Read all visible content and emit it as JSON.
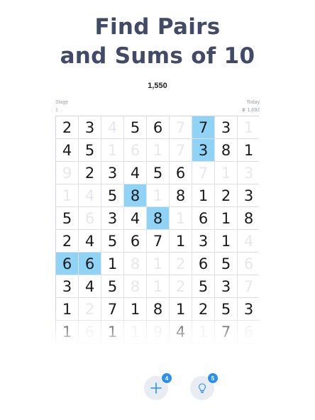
{
  "headline": {
    "line1": "Find Pairs",
    "line2": "and Sums of 10"
  },
  "score": "1,550",
  "stage": {
    "label": "Stage",
    "value": "1"
  },
  "today": {
    "label": "Today",
    "value": "1,692"
  },
  "grid": {
    "rows": [
      [
        {
          "v": "2",
          "s": "a"
        },
        {
          "v": "3",
          "s": "a"
        },
        {
          "v": "4",
          "s": "c"
        },
        {
          "v": "5",
          "s": "a"
        },
        {
          "v": "6",
          "s": "a"
        },
        {
          "v": "7",
          "s": "c"
        },
        {
          "v": "7",
          "s": "sel"
        },
        {
          "v": "3",
          "s": "a"
        },
        {
          "v": "1",
          "s": "c"
        }
      ],
      [
        {
          "v": "4",
          "s": "a"
        },
        {
          "v": "5",
          "s": "a"
        },
        {
          "v": "1",
          "s": "c"
        },
        {
          "v": "6",
          "s": "c"
        },
        {
          "v": "1",
          "s": "c"
        },
        {
          "v": "7",
          "s": "c"
        },
        {
          "v": "3",
          "s": "sel"
        },
        {
          "v": "8",
          "s": "a"
        },
        {
          "v": "1",
          "s": "a"
        }
      ],
      [
        {
          "v": "9",
          "s": "c"
        },
        {
          "v": "2",
          "s": "a"
        },
        {
          "v": "3",
          "s": "a"
        },
        {
          "v": "4",
          "s": "a"
        },
        {
          "v": "5",
          "s": "a"
        },
        {
          "v": "6",
          "s": "a"
        },
        {
          "v": "7",
          "s": "c"
        },
        {
          "v": "1",
          "s": "c"
        },
        {
          "v": "3",
          "s": "c"
        }
      ],
      [
        {
          "v": "1",
          "s": "c"
        },
        {
          "v": "4",
          "s": "c"
        },
        {
          "v": "5",
          "s": "a"
        },
        {
          "v": "8",
          "s": "sel"
        },
        {
          "v": "1",
          "s": "c"
        },
        {
          "v": "8",
          "s": "a"
        },
        {
          "v": "1",
          "s": "a"
        },
        {
          "v": "2",
          "s": "a"
        },
        {
          "v": "3",
          "s": "a"
        }
      ],
      [
        {
          "v": "5",
          "s": "a"
        },
        {
          "v": "6",
          "s": "c"
        },
        {
          "v": "3",
          "s": "a"
        },
        {
          "v": "4",
          "s": "a"
        },
        {
          "v": "8",
          "s": "sel"
        },
        {
          "v": "1",
          "s": "c"
        },
        {
          "v": "6",
          "s": "a"
        },
        {
          "v": "1",
          "s": "a"
        },
        {
          "v": "8",
          "s": "a"
        }
      ],
      [
        {
          "v": "2",
          "s": "a"
        },
        {
          "v": "4",
          "s": "a"
        },
        {
          "v": "5",
          "s": "a"
        },
        {
          "v": "6",
          "s": "a"
        },
        {
          "v": "7",
          "s": "a"
        },
        {
          "v": "1",
          "s": "a"
        },
        {
          "v": "3",
          "s": "a"
        },
        {
          "v": "1",
          "s": "a"
        },
        {
          "v": "4",
          "s": "c"
        }
      ],
      [
        {
          "v": "6",
          "s": "sel"
        },
        {
          "v": "6",
          "s": "sel"
        },
        {
          "v": "1",
          "s": "a"
        },
        {
          "v": "8",
          "s": "c"
        },
        {
          "v": "1",
          "s": "c"
        },
        {
          "v": "2",
          "s": "c"
        },
        {
          "v": "6",
          "s": "a"
        },
        {
          "v": "5",
          "s": "a"
        },
        {
          "v": "6",
          "s": "c"
        }
      ],
      [
        {
          "v": "3",
          "s": "a"
        },
        {
          "v": "4",
          "s": "a"
        },
        {
          "v": "5",
          "s": "a"
        },
        {
          "v": "8",
          "s": "c"
        },
        {
          "v": "1",
          "s": "c"
        },
        {
          "v": "2",
          "s": "c"
        },
        {
          "v": "5",
          "s": "a"
        },
        {
          "v": "3",
          "s": "a"
        },
        {
          "v": "7",
          "s": "c"
        }
      ],
      [
        {
          "v": "1",
          "s": "a"
        },
        {
          "v": "2",
          "s": "c"
        },
        {
          "v": "7",
          "s": "a"
        },
        {
          "v": "1",
          "s": "a"
        },
        {
          "v": "8",
          "s": "a"
        },
        {
          "v": "1",
          "s": "a"
        },
        {
          "v": "2",
          "s": "a"
        },
        {
          "v": "5",
          "s": "a"
        },
        {
          "v": "3",
          "s": "a"
        }
      ],
      [
        {
          "v": "1",
          "s": "a"
        },
        {
          "v": "6",
          "s": "c"
        },
        {
          "v": "1",
          "s": "a"
        },
        {
          "v": "1",
          "s": "c"
        },
        {
          "v": "9",
          "s": "c"
        },
        {
          "v": "4",
          "s": "a"
        },
        {
          "v": "1",
          "s": "c"
        },
        {
          "v": "7",
          "s": "a"
        },
        {
          "v": "6",
          "s": "c"
        }
      ]
    ]
  },
  "buttons": {
    "add": {
      "icon": "plus-icon",
      "badge": "4"
    },
    "hint": {
      "icon": "lightbulb-icon",
      "badge": "5"
    }
  },
  "colors": {
    "highlight": "#8fd3f6",
    "headline": "#414a66",
    "badge": "#2d8ff0"
  }
}
